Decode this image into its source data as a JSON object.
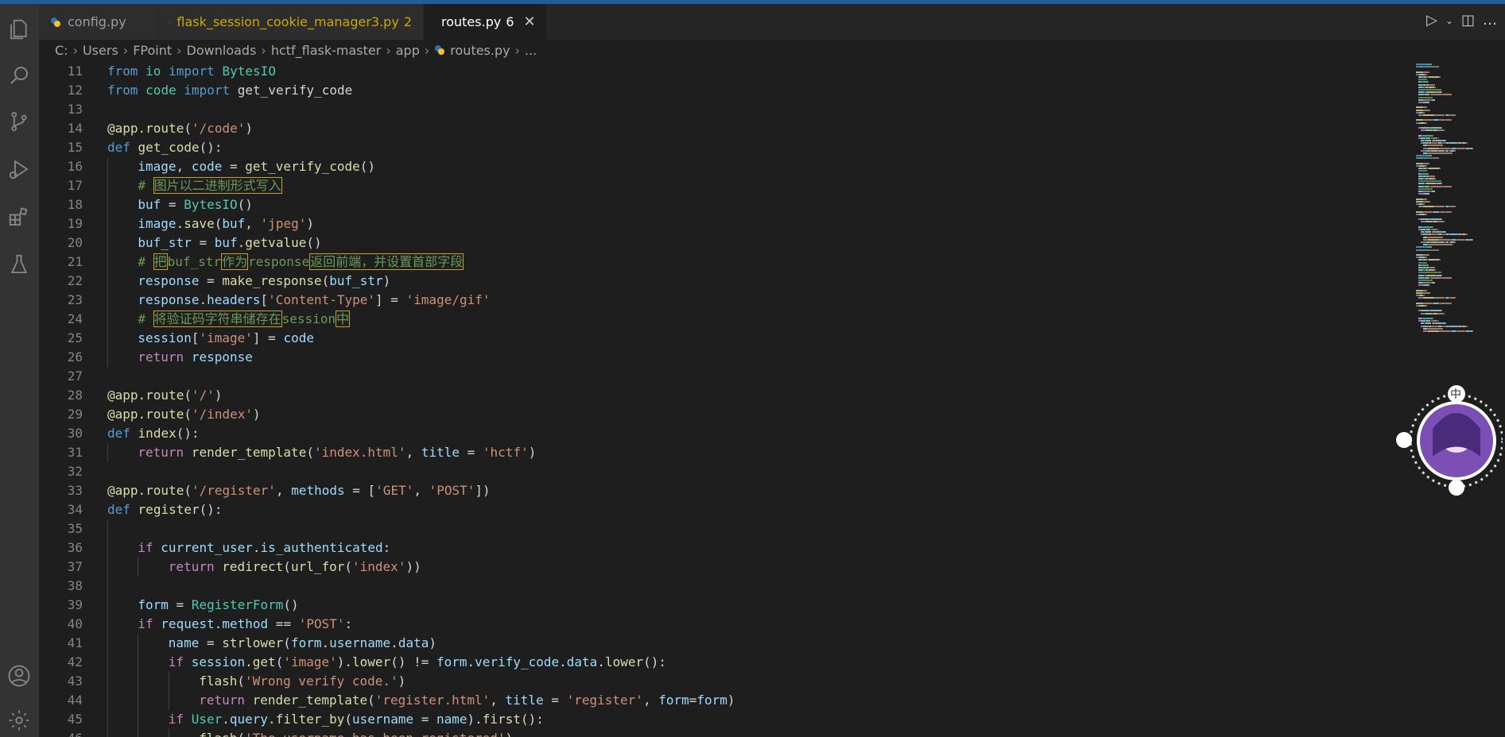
{
  "tabs": [
    {
      "label": "config.py",
      "active": false,
      "modified": false,
      "badge": ""
    },
    {
      "label": "flask_session_cookie_manager3.py",
      "active": false,
      "modified": true,
      "badge": "2"
    },
    {
      "label": "routes.py",
      "active": true,
      "modified": false,
      "badge": "6"
    }
  ],
  "breadcrumb": [
    "C:",
    "Users",
    "FPoint",
    "Downloads",
    "hctf_flask-master",
    "app",
    "routes.py",
    "..."
  ],
  "activity_icons": [
    "explorer-icon",
    "search-icon",
    "source-control-icon",
    "run-debug-icon",
    "extensions-icon",
    "testing-icon",
    "account-icon",
    "settings-icon"
  ],
  "editor_lines": [
    {
      "n": "11",
      "indent": 0,
      "tokens": [
        [
          "kw",
          "from"
        ],
        [
          "plain",
          " "
        ],
        [
          "cls",
          "io"
        ],
        [
          "plain",
          " "
        ],
        [
          "kw",
          "import"
        ],
        [
          "plain",
          " "
        ],
        [
          "cls",
          "BytesIO"
        ]
      ]
    },
    {
      "n": "12",
      "indent": 0,
      "tokens": [
        [
          "kw",
          "from"
        ],
        [
          "plain",
          " "
        ],
        [
          "cls",
          "code"
        ],
        [
          "plain",
          " "
        ],
        [
          "kw",
          "import"
        ],
        [
          "plain",
          " "
        ],
        [
          "plain",
          "get_verify_code"
        ]
      ]
    },
    {
      "n": "13",
      "indent": 0,
      "tokens": []
    },
    {
      "n": "14",
      "indent": 0,
      "tokens": [
        [
          "fn",
          "@app.route"
        ],
        [
          "plain",
          "("
        ],
        [
          "str",
          "'/code'"
        ],
        [
          "plain",
          ")"
        ]
      ]
    },
    {
      "n": "15",
      "indent": 0,
      "tokens": [
        [
          "kw",
          "def"
        ],
        [
          "plain",
          " "
        ],
        [
          "fn",
          "get_code"
        ],
        [
          "plain",
          "():"
        ]
      ]
    },
    {
      "n": "16",
      "indent": 1,
      "tokens": [
        [
          "var",
          "image"
        ],
        [
          "plain",
          ", "
        ],
        [
          "var",
          "code"
        ],
        [
          "plain",
          " = "
        ],
        [
          "fn",
          "get_verify_code"
        ],
        [
          "plain",
          "()"
        ]
      ]
    },
    {
      "n": "17",
      "indent": 1,
      "tokens": [
        [
          "cmt",
          "# "
        ],
        [
          "cmt hl",
          "图片以二进制形式写入"
        ]
      ]
    },
    {
      "n": "18",
      "indent": 1,
      "tokens": [
        [
          "var",
          "buf"
        ],
        [
          "plain",
          " = "
        ],
        [
          "cls",
          "BytesIO"
        ],
        [
          "plain",
          "()"
        ]
      ]
    },
    {
      "n": "19",
      "indent": 1,
      "tokens": [
        [
          "var",
          "image"
        ],
        [
          "plain",
          "."
        ],
        [
          "fn",
          "save"
        ],
        [
          "plain",
          "("
        ],
        [
          "var",
          "buf"
        ],
        [
          "plain",
          ", "
        ],
        [
          "str",
          "'jpeg'"
        ],
        [
          "plain",
          ")"
        ]
      ]
    },
    {
      "n": "20",
      "indent": 1,
      "tokens": [
        [
          "var",
          "buf_str"
        ],
        [
          "plain",
          " = "
        ],
        [
          "var",
          "buf"
        ],
        [
          "plain",
          "."
        ],
        [
          "fn",
          "getvalue"
        ],
        [
          "plain",
          "()"
        ]
      ]
    },
    {
      "n": "21",
      "indent": 1,
      "tokens": [
        [
          "cmt",
          "# "
        ],
        [
          "cmt hl",
          "把"
        ],
        [
          "cmt",
          "buf_str"
        ],
        [
          "cmt hl",
          "作为"
        ],
        [
          "cmt",
          "response"
        ],
        [
          "cmt hl",
          "返回前端，并设置首部字段"
        ]
      ]
    },
    {
      "n": "22",
      "indent": 1,
      "tokens": [
        [
          "var",
          "response"
        ],
        [
          "plain",
          " = "
        ],
        [
          "fn",
          "make_response"
        ],
        [
          "plain",
          "("
        ],
        [
          "var",
          "buf_str"
        ],
        [
          "plain",
          ")"
        ]
      ]
    },
    {
      "n": "23",
      "indent": 1,
      "tokens": [
        [
          "var",
          "response"
        ],
        [
          "plain",
          "."
        ],
        [
          "var",
          "headers"
        ],
        [
          "plain",
          "["
        ],
        [
          "str",
          "'Content-Type'"
        ],
        [
          "plain",
          "] = "
        ],
        [
          "str",
          "'image/gif'"
        ]
      ]
    },
    {
      "n": "24",
      "indent": 1,
      "tokens": [
        [
          "cmt",
          "# "
        ],
        [
          "cmt hl",
          "将验证码字符串储存在"
        ],
        [
          "cmt",
          "session"
        ],
        [
          "cmt hl",
          "中"
        ]
      ]
    },
    {
      "n": "25",
      "indent": 1,
      "tokens": [
        [
          "var",
          "session"
        ],
        [
          "plain",
          "["
        ],
        [
          "str",
          "'image'"
        ],
        [
          "plain",
          "] = "
        ],
        [
          "var",
          "code"
        ]
      ]
    },
    {
      "n": "26",
      "indent": 1,
      "tokens": [
        [
          "ctl",
          "return"
        ],
        [
          "plain",
          " "
        ],
        [
          "var",
          "response"
        ]
      ]
    },
    {
      "n": "27",
      "indent": 0,
      "tokens": []
    },
    {
      "n": "28",
      "indent": 0,
      "tokens": [
        [
          "fn",
          "@app.route"
        ],
        [
          "plain",
          "("
        ],
        [
          "str",
          "'/'"
        ],
        [
          "plain",
          ")"
        ]
      ]
    },
    {
      "n": "29",
      "indent": 0,
      "tokens": [
        [
          "fn",
          "@app.route"
        ],
        [
          "plain",
          "("
        ],
        [
          "str",
          "'/index'"
        ],
        [
          "plain",
          ")"
        ]
      ]
    },
    {
      "n": "30",
      "indent": 0,
      "tokens": [
        [
          "kw",
          "def"
        ],
        [
          "plain",
          " "
        ],
        [
          "fn",
          "index"
        ],
        [
          "plain",
          "():"
        ]
      ]
    },
    {
      "n": "31",
      "indent": 1,
      "tokens": [
        [
          "ctl",
          "return"
        ],
        [
          "plain",
          " "
        ],
        [
          "fn",
          "render_template"
        ],
        [
          "plain",
          "("
        ],
        [
          "str",
          "'index.html'"
        ],
        [
          "plain",
          ", "
        ],
        [
          "var",
          "title"
        ],
        [
          "plain",
          " = "
        ],
        [
          "str",
          "'hctf'"
        ],
        [
          "plain",
          ")"
        ]
      ]
    },
    {
      "n": "32",
      "indent": 0,
      "tokens": []
    },
    {
      "n": "33",
      "indent": 0,
      "tokens": [
        [
          "fn",
          "@app.route"
        ],
        [
          "plain",
          "("
        ],
        [
          "str",
          "'/register'"
        ],
        [
          "plain",
          ", "
        ],
        [
          "var",
          "methods"
        ],
        [
          "plain",
          " = ["
        ],
        [
          "str",
          "'GET'"
        ],
        [
          "plain",
          ", "
        ],
        [
          "str",
          "'POST'"
        ],
        [
          "plain",
          "])"
        ]
      ]
    },
    {
      "n": "34",
      "indent": 0,
      "tokens": [
        [
          "kw",
          "def"
        ],
        [
          "plain",
          " "
        ],
        [
          "fn",
          "register"
        ],
        [
          "plain",
          "():"
        ]
      ]
    },
    {
      "n": "35",
      "indent": 1,
      "tokens": []
    },
    {
      "n": "36",
      "indent": 1,
      "tokens": [
        [
          "ctl",
          "if"
        ],
        [
          "plain",
          " "
        ],
        [
          "var",
          "current_user"
        ],
        [
          "plain",
          "."
        ],
        [
          "var",
          "is_authenticated"
        ],
        [
          "plain",
          ":"
        ]
      ]
    },
    {
      "n": "37",
      "indent": 2,
      "tokens": [
        [
          "ctl",
          "return"
        ],
        [
          "plain",
          " "
        ],
        [
          "fn",
          "redirect"
        ],
        [
          "plain",
          "("
        ],
        [
          "fn",
          "url_for"
        ],
        [
          "plain",
          "("
        ],
        [
          "str",
          "'index'"
        ],
        [
          "plain",
          "))"
        ]
      ]
    },
    {
      "n": "38",
      "indent": 1,
      "tokens": []
    },
    {
      "n": "39",
      "indent": 1,
      "tokens": [
        [
          "var",
          "form"
        ],
        [
          "plain",
          " = "
        ],
        [
          "cls",
          "RegisterForm"
        ],
        [
          "plain",
          "()"
        ]
      ]
    },
    {
      "n": "40",
      "indent": 1,
      "tokens": [
        [
          "ctl",
          "if"
        ],
        [
          "plain",
          " "
        ],
        [
          "var",
          "request"
        ],
        [
          "plain",
          "."
        ],
        [
          "var",
          "method"
        ],
        [
          "plain",
          " == "
        ],
        [
          "str",
          "'POST'"
        ],
        [
          "plain",
          ":"
        ]
      ]
    },
    {
      "n": "41",
      "indent": 2,
      "tokens": [
        [
          "var",
          "name"
        ],
        [
          "plain",
          " = "
        ],
        [
          "fn",
          "strlower"
        ],
        [
          "plain",
          "("
        ],
        [
          "var",
          "form"
        ],
        [
          "plain",
          "."
        ],
        [
          "var",
          "username"
        ],
        [
          "plain",
          "."
        ],
        [
          "var",
          "data"
        ],
        [
          "plain",
          ")"
        ]
      ]
    },
    {
      "n": "42",
      "indent": 2,
      "tokens": [
        [
          "ctl",
          "if"
        ],
        [
          "plain",
          " "
        ],
        [
          "var",
          "session"
        ],
        [
          "plain",
          "."
        ],
        [
          "fn",
          "get"
        ],
        [
          "plain",
          "("
        ],
        [
          "str",
          "'image'"
        ],
        [
          "plain",
          ")."
        ],
        [
          "fn",
          "lower"
        ],
        [
          "plain",
          "() != "
        ],
        [
          "var",
          "form"
        ],
        [
          "plain",
          "."
        ],
        [
          "var",
          "verify_code"
        ],
        [
          "plain",
          "."
        ],
        [
          "var",
          "data"
        ],
        [
          "plain",
          "."
        ],
        [
          "fn",
          "lower"
        ],
        [
          "plain",
          "():"
        ]
      ]
    },
    {
      "n": "43",
      "indent": 3,
      "tokens": [
        [
          "fn",
          "flash"
        ],
        [
          "plain",
          "("
        ],
        [
          "str",
          "'Wrong verify code.'"
        ],
        [
          "plain",
          ")"
        ]
      ]
    },
    {
      "n": "44",
      "indent": 3,
      "tokens": [
        [
          "ctl",
          "return"
        ],
        [
          "plain",
          " "
        ],
        [
          "fn",
          "render_template"
        ],
        [
          "plain",
          "("
        ],
        [
          "str",
          "'register.html'"
        ],
        [
          "plain",
          ", "
        ],
        [
          "var",
          "title"
        ],
        [
          "plain",
          " = "
        ],
        [
          "str",
          "'register'"
        ],
        [
          "plain",
          ", "
        ],
        [
          "var",
          "form"
        ],
        [
          "plain",
          "="
        ],
        [
          "var",
          "form"
        ],
        [
          "plain",
          ")"
        ]
      ]
    },
    {
      "n": "45",
      "indent": 2,
      "tokens": [
        [
          "ctl",
          "if"
        ],
        [
          "plain",
          " "
        ],
        [
          "cls",
          "User"
        ],
        [
          "plain",
          "."
        ],
        [
          "var",
          "query"
        ],
        [
          "plain",
          "."
        ],
        [
          "fn",
          "filter_by"
        ],
        [
          "plain",
          "("
        ],
        [
          "var",
          "username"
        ],
        [
          "plain",
          " = "
        ],
        [
          "var",
          "name"
        ],
        [
          "plain",
          ")."
        ],
        [
          "fn",
          "first"
        ],
        [
          "plain",
          "():"
        ]
      ]
    },
    {
      "n": "46",
      "indent": 3,
      "tokens": [
        [
          "fn",
          "flash"
        ],
        [
          "plain",
          "("
        ],
        [
          "str",
          "'The username has been registered'"
        ],
        [
          "plain",
          ")"
        ]
      ]
    }
  ],
  "avatar": {
    "label": "中"
  }
}
